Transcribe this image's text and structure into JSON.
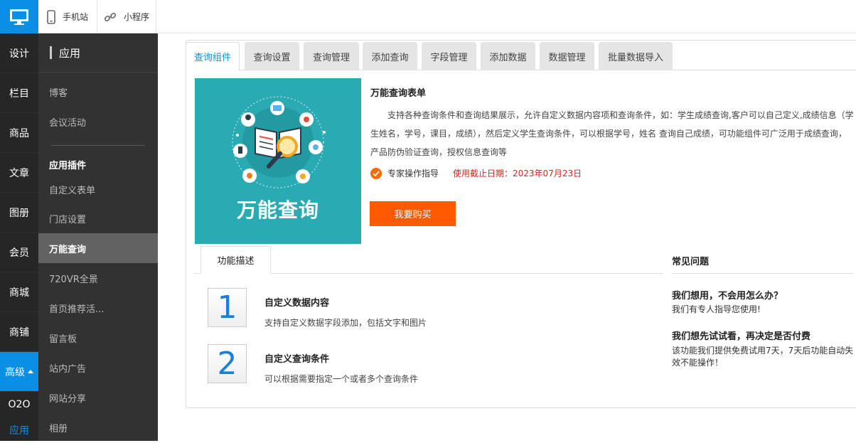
{
  "topbar": {
    "logo_icon": "desktop-monitor-icon",
    "mobile_label": "手机站",
    "mobile_icon": "phone-icon",
    "miniapp_label": "小程序",
    "miniapp_icon": "link-icon"
  },
  "leftnav": {
    "items": [
      "设计",
      "栏目",
      "商品",
      "文章",
      "图册",
      "会员",
      "商城",
      "商铺",
      "高级"
    ],
    "active": "高级",
    "o2o": "O2O",
    "app": "应用"
  },
  "subnav": {
    "title": "应用",
    "links_top": [
      "博客",
      "会议活动"
    ],
    "group_label": "应用插件",
    "links_plugins": [
      "自定义表单",
      "门店设置",
      "万能查询",
      "720VR全景",
      "首页推荐活...",
      "留言板",
      "站内广告",
      "网站分享",
      "相册"
    ],
    "active": "万能查询"
  },
  "tabs": [
    "查询组件",
    "查询设置",
    "查询管理",
    "添加查询",
    "字段管理",
    "添加数据",
    "数据管理",
    "批量数据导入"
  ],
  "hero": {
    "title": "万能查询"
  },
  "intro": {
    "title": "万能查询表单",
    "description": "支持各种查询条件和查询结果展示，允许自定义数据内容项和查询条件，如：学生成绩查询,客户可以自己定义,成绩信息（学生姓名，学号，课目，成绩），然后定义学生查询条件，可以根据学号，姓名 查询自己成绩，可功能组件可广泛用于成绩查询，产品防伪验证查询，授权信息查询等",
    "guide_label": "专家操作指导",
    "expire_text": "使用截止日期：2023年07月23日",
    "buy_label": "我要购买"
  },
  "features": {
    "tab_label": "功能描述",
    "items": [
      {
        "num": "1",
        "title": "自定义数据内容",
        "desc": "支持自定义数据字段添加，包括文字和图片"
      },
      {
        "num": "2",
        "title": "自定义查询条件",
        "desc": "可以根据需要指定一个或者多个查询条件"
      }
    ]
  },
  "faq": {
    "title": "常见问题",
    "items": [
      {
        "q": "我们想用，不会用怎么办？",
        "a": "我们有专人指导您使用!"
      },
      {
        "q": "我们想先试试看，再决定是否付费",
        "a": "该功能我们提供免费试用7天，7天后功能自动失效不能操作！"
      }
    ]
  },
  "colors": {
    "accent": "#0a8fe6",
    "buy": "#ff5a00",
    "expire": "#e0201a",
    "hero_bg": "#2aaab2"
  }
}
